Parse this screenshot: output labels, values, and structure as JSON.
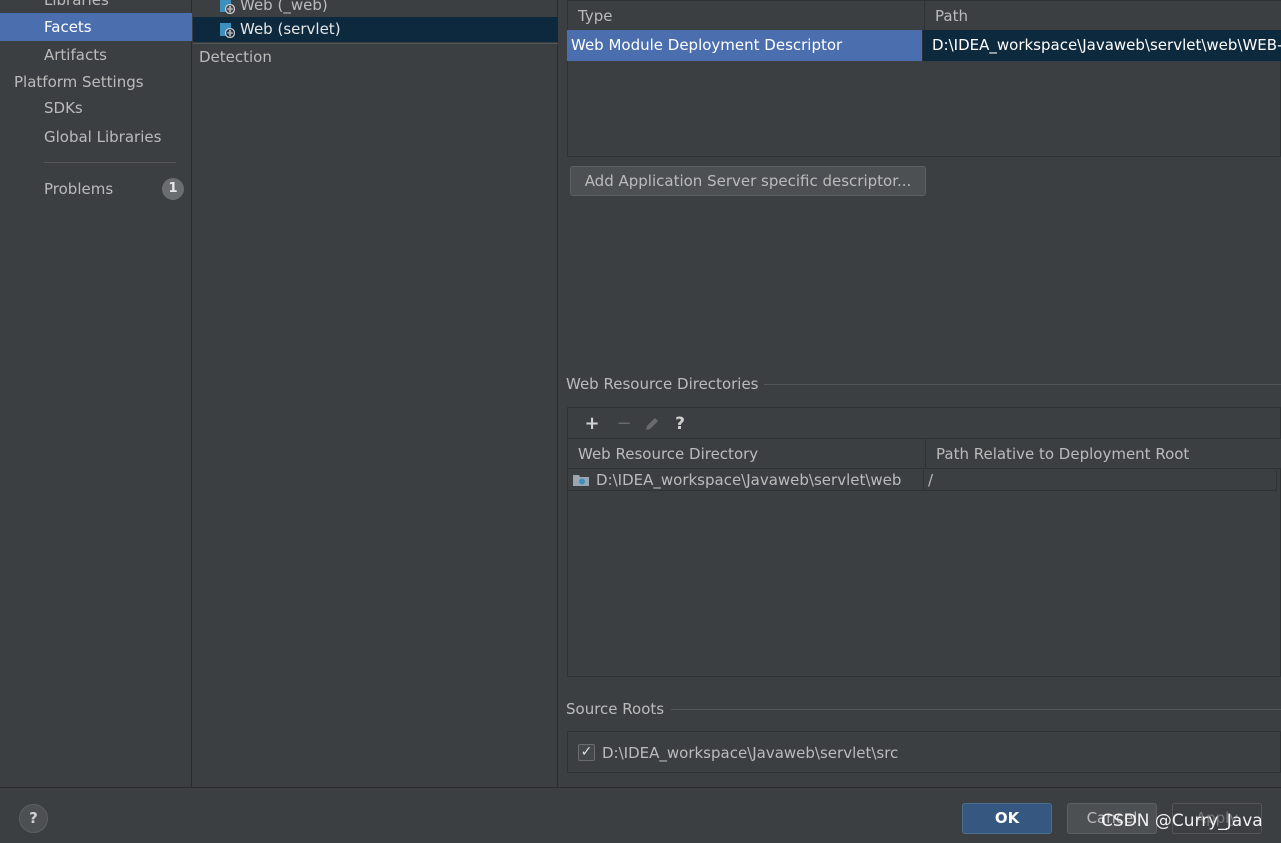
{
  "left_nav": {
    "items_top": [
      {
        "label": "Libraries"
      },
      {
        "label": "Facets"
      },
      {
        "label": "Artifacts"
      }
    ],
    "platform_settings_header": "Platform Settings",
    "platform_items": [
      {
        "label": "SDKs"
      },
      {
        "label": "Global Libraries"
      }
    ],
    "problems": {
      "label": "Problems",
      "count": "1"
    }
  },
  "facet_tree": {
    "items": [
      {
        "label": "Web (_web)"
      },
      {
        "label": "Web (servlet)"
      }
    ],
    "detection_label": "Detection"
  },
  "deployment_descriptors": {
    "columns": [
      "Type",
      "Path"
    ],
    "rows": [
      {
        "type": "Web Module Deployment Descriptor",
        "path": "D:\\IDEA_workspace\\Javaweb\\servlet\\web\\WEB-INF\\web.xml"
      }
    ],
    "add_button_label": "Add Application Server specific descriptor..."
  },
  "web_resource_directories": {
    "title": "Web Resource Directories",
    "toolbar": {
      "add": "+",
      "remove": "−",
      "help": "?"
    },
    "columns": [
      "Web Resource Directory",
      "Path Relative to Deployment Root"
    ],
    "rows": [
      {
        "directory": "D:\\IDEA_workspace\\Javaweb\\servlet\\web",
        "relative_path": "/"
      }
    ]
  },
  "source_roots": {
    "title": "Source Roots",
    "items": [
      {
        "checked_mark": "✓",
        "path": "D:\\IDEA_workspace\\Javaweb\\servlet\\src"
      }
    ]
  },
  "dialog_buttons": {
    "help": "?",
    "ok": "OK",
    "cancel": "Cancel",
    "apply": "Apply"
  },
  "watermark": "CSDN @Curry_Java",
  "colors": {
    "background": "#3c3f41",
    "selection": "#4b6eaf",
    "selection_inactive": "#0d293e",
    "ok_button": "#365880"
  }
}
